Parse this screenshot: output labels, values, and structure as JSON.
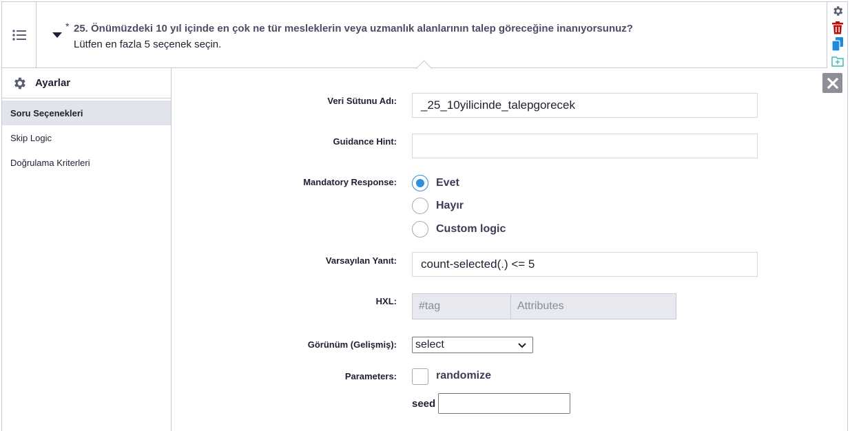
{
  "question": {
    "required_marker": "*",
    "label": "25. Önümüzdeki 10 yıl içinde en çok ne tür mesleklerin veya uzmanlık alanlarının talep göreceğine inanıyorsunuz?",
    "hint": "Lütfen en fazla 5 seçenek seçin."
  },
  "toolbar": {
    "icons": [
      "gear-icon",
      "trash-icon",
      "copy-icon",
      "add-to-library-icon"
    ],
    "colors": {
      "gear": "#5c5e73",
      "trash": "#c20d0d",
      "copy": "#1c8ae0",
      "library": "#3fb9b0"
    }
  },
  "sidebar": {
    "title": "Ayarlar",
    "items": [
      {
        "label": "Soru Seçenekleri",
        "active": true
      },
      {
        "label": "Skip Logic",
        "active": false
      },
      {
        "label": "Doğrulama Kriterleri",
        "active": false
      }
    ]
  },
  "form": {
    "data_column": {
      "label": "Veri Sütunu Adı:",
      "value": "_25_10yilicinde_talepgorecek"
    },
    "guidance": {
      "label": "Guidance Hint:",
      "value": ""
    },
    "mandatory": {
      "label": "Mandatory Response:",
      "options": [
        "Evet",
        "Hayır",
        "Custom logic"
      ],
      "selected": "Evet"
    },
    "default_answer": {
      "label": "Varsayılan Yanıt:",
      "value": "count-selected(.) <= 5"
    },
    "hxl": {
      "label": "HXL:",
      "tag_placeholder": "#tag",
      "attributes_placeholder": "Attributes"
    },
    "appearance": {
      "label": "Görünüm (Gelişmiş):",
      "value": "select"
    },
    "parameters": {
      "label": "Parameters:",
      "randomize_label": "randomize",
      "randomize_checked": false,
      "seed_label": "seed",
      "seed_value": ""
    }
  },
  "colors": {
    "accent": "#2b8fe0",
    "border": "#c8c9d6",
    "active_bg": "#e2e4ec",
    "close_bg": "#8e8e98"
  }
}
